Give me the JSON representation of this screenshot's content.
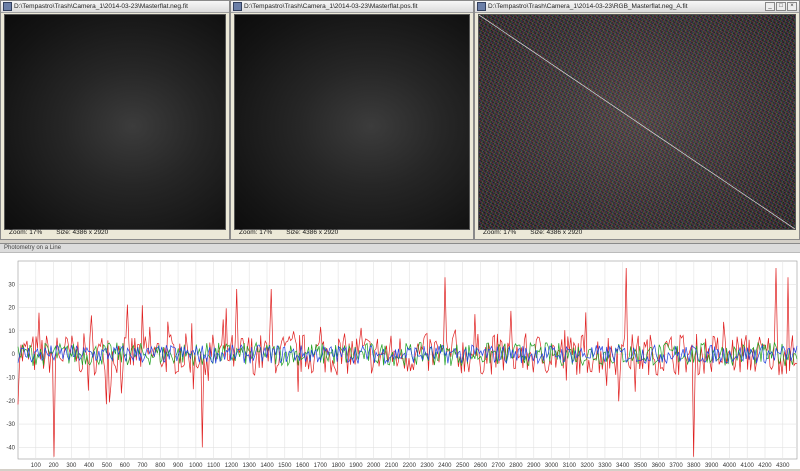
{
  "windows": [
    {
      "title": "D:\\Tempastro\\Trash\\Camera_1\\2014-03-23\\Masterflat.neg.fit",
      "zoom": "Zoom: 17%",
      "size": "Size: 4386 x 2920",
      "image": "flat"
    },
    {
      "title": "D:\\Tempastro\\Trash\\Camera_1\\2014-03-23\\Masterflat.pos.fit",
      "zoom": "Zoom: 17%",
      "size": "Size: 4386 x 2920",
      "image": "flat"
    },
    {
      "title": "D:\\Tempastro\\Trash\\Camera_1\\2014-03-23\\RGB_Masterflat.neg_A.fit",
      "zoom": "Zoom: 17%",
      "size": "Size: 4386 x 2920",
      "image": "noise"
    }
  ],
  "profile": {
    "title": "Photometry on a Line",
    "chart_data": {
      "type": "line",
      "ylim": [
        -45,
        40
      ],
      "xlim": [
        0,
        4380
      ],
      "yticks": [
        30,
        20,
        10,
        0,
        -10,
        -20,
        -30,
        -40
      ],
      "xticks": [
        100,
        200,
        300,
        400,
        500,
        600,
        700,
        800,
        900,
        1000,
        1100,
        1200,
        1300,
        1400,
        1500,
        1600,
        1700,
        1800,
        1900,
        2000,
        2100,
        2200,
        2300,
        2400,
        2500,
        2600,
        2700,
        2800,
        2900,
        3000,
        3100,
        3200,
        3300,
        3400,
        3500,
        3600,
        3700,
        3800,
        3900,
        4000,
        4100,
        4200,
        4300
      ],
      "grid": true,
      "series": [
        {
          "color": "#e02020",
          "amplitude": 9,
          "spikes": [
            [
              1040,
              -40
            ],
            [
              1230,
              28
            ],
            [
              1420,
              28
            ],
            [
              2400,
              33
            ],
            [
              3420,
              37
            ],
            [
              3800,
              -44
            ],
            [
              4260,
              37
            ],
            [
              4330,
              33
            ],
            [
              200,
              -44
            ]
          ]
        },
        {
          "color": "#20a020",
          "amplitude": 5,
          "spikes": []
        },
        {
          "color": "#2040e0",
          "amplitude": 4,
          "spikes": []
        }
      ]
    }
  }
}
